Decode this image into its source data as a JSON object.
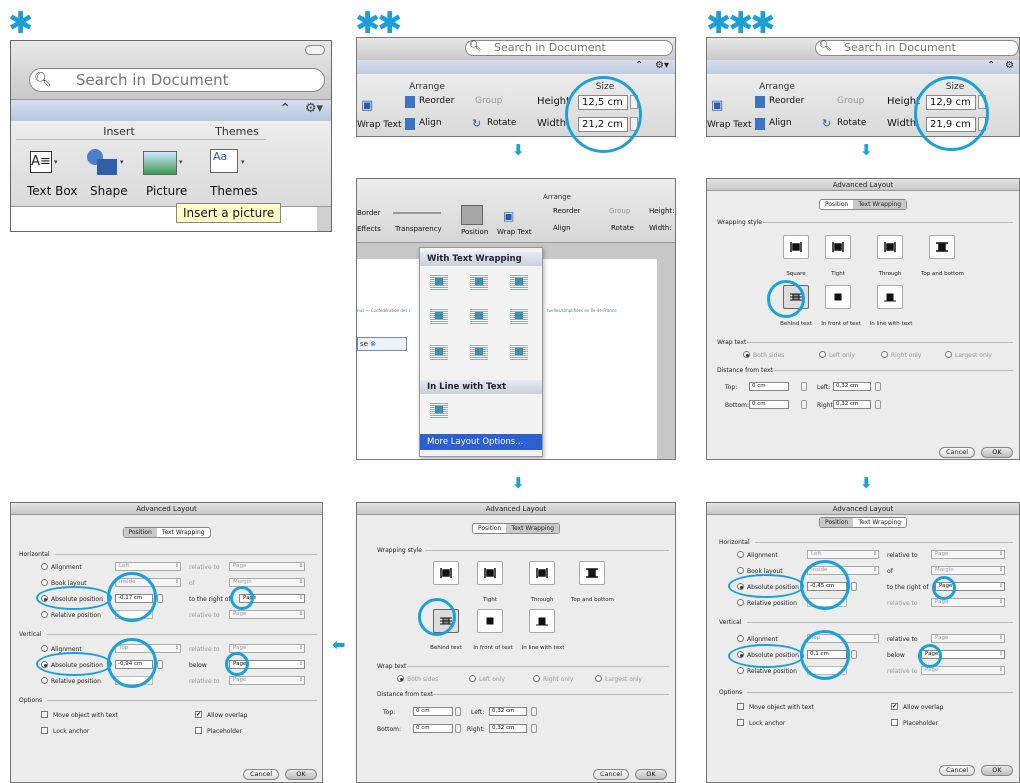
{
  "markers": {
    "step1": "✱",
    "step2": "✱✱",
    "step3": "✱✱✱"
  },
  "panel1": {
    "search_placeholder": "Search in Document",
    "insert_group": "Insert",
    "themes_group": "Themes",
    "buttons": [
      "Text Box",
      "Shape",
      "Picture",
      "Themes"
    ],
    "tooltip": "Insert a picture"
  },
  "size_panel": {
    "search_placeholder": "Search in Document",
    "arrange_label": "Arrange",
    "size_label": "Size",
    "reorder": "Reorder",
    "group": "Group",
    "align": "Align",
    "rotate": "Rotate",
    "wrap_text": "Wrap Text",
    "height_label": "Height",
    "width_label": "Width",
    "panel2": {
      "height": "12,5 cm",
      "width": "21,2 cm"
    },
    "panel3": {
      "height": "12,9 cm",
      "width": "21,9 cm"
    }
  },
  "position_menu": {
    "arrange_label": "Arrange",
    "border": "Border",
    "effects": "Effects",
    "transparency": "Transparency",
    "position": "Position",
    "wrap_text": "Wrap Text",
    "reorder": "Reorder",
    "group": "Group",
    "align": "Align",
    "rotate": "Rotate",
    "height": "Height:",
    "width": "Width:",
    "with_text_wrapping": "With Text Wrapping",
    "in_line_with_text": "In Line with Text",
    "more_layout": "More Layout Options...",
    "doc_text": "nus — Confédération des r",
    "doc_text2": "tuelles/simplifiées en Île-de-France",
    "doc_tab": "se"
  },
  "dialog": {
    "title": "Advanced Layout",
    "tab_position": "Position",
    "tab_wrapping": "Text Wrapping",
    "wrapping_style": "Wrapping style",
    "styles": [
      "Square",
      "Tight",
      "Through",
      "Top and bottom",
      "Behind text",
      "In front of text",
      "In line with text"
    ],
    "wrap_text": "Wrap text",
    "wrap_options": [
      "Both sides",
      "Left only",
      "Right only",
      "Largest only"
    ],
    "distance": "Distance from text",
    "top": "Top:",
    "bottom": "Bottom:",
    "left": "Left:",
    "right": "Right:",
    "top_val": "0 cm",
    "bottom_val": "0 cm",
    "left_val": "0,32 cm",
    "right_val": "0,32 cm",
    "cancel": "Cancel",
    "ok": "OK",
    "horizontal": "Horizontal",
    "vertical": "Vertical",
    "options": "Options",
    "alignment": "Alignment",
    "book_layout": "Book layout",
    "absolute_position": "Absolute position",
    "relative_position": "Relative position",
    "relative_to": "relative to",
    "of": "of",
    "to_the_right_of": "to the right of",
    "below": "below",
    "left_opt": "Left",
    "inside_opt": "Inside",
    "top_opt": "Top",
    "page": "Page",
    "margin": "Margin",
    "move_object": "Move object with text",
    "allow_overlap": "Allow overlap",
    "lock_anchor": "Lock anchor",
    "placeholder": "Placeholder",
    "left_dialog": {
      "h_abs": "-0,17 cm",
      "v_abs": "-0,94 cm"
    },
    "right_dialog": {
      "h_abs": "-0,45 cm",
      "v_abs": "0,1 cm"
    }
  },
  "colors": {
    "accent": "#1aa1db"
  }
}
